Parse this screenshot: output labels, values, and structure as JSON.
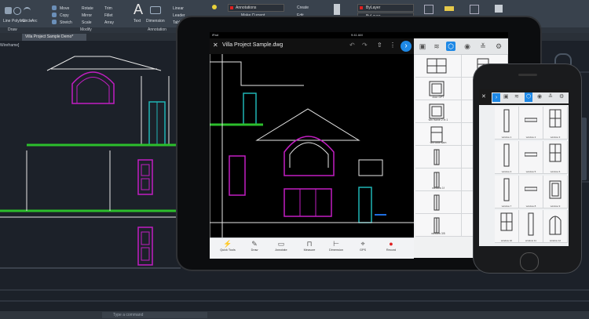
{
  "ribbon": {
    "tools": [
      {
        "label": "Line",
        "icon": "line-icon"
      },
      {
        "label": "Polyline",
        "icon": "polyline-icon"
      },
      {
        "label": "Circle",
        "icon": "circle-icon"
      },
      {
        "label": "Arc",
        "icon": "arc-icon"
      },
      {
        "label": "Move",
        "icon": "move-icon"
      },
      {
        "label": "Rotate",
        "icon": "rotate-icon"
      },
      {
        "label": "Trim",
        "icon": "trim-icon"
      },
      {
        "label": "Copy",
        "icon": "copy-icon"
      },
      {
        "label": "Mirror",
        "icon": "mirror-icon"
      },
      {
        "label": "Fillet",
        "icon": "fillet-icon"
      },
      {
        "label": "Stretch",
        "icon": "stretch-icon"
      },
      {
        "label": "Scale",
        "icon": "scale-icon"
      },
      {
        "label": "Array",
        "icon": "array-icon"
      },
      {
        "label": "Text",
        "icon": "text-icon"
      },
      {
        "label": "Dimension",
        "icon": "dimension-icon"
      },
      {
        "label": "Linear",
        "icon": "linear-icon"
      },
      {
        "label": "Leader",
        "icon": "leader-icon"
      },
      {
        "label": "Table",
        "icon": "table-icon"
      },
      {
        "label": "Annotations",
        "icon": "layer-icon"
      },
      {
        "label": "Make Current",
        "icon": "make-current-icon"
      },
      {
        "label": "Create",
        "icon": "create-icon"
      },
      {
        "label": "Edit",
        "icon": "edit-icon"
      },
      {
        "label": "ByLayer",
        "icon": "color-icon"
      },
      {
        "label": "ByLayer",
        "icon": "linetype-icon"
      }
    ],
    "panels": [
      "Draw",
      "Modify",
      "Annotation"
    ]
  },
  "file_tab": "Villa Project Sample Demo*",
  "viewport_label": "Wireframe]",
  "command_placeholder": "Type a command",
  "tablet": {
    "status_left": "iPad",
    "status_time": "9:41 AM",
    "title": "Villa Project Sample.dwg",
    "toolbar": [
      {
        "label": "Quick Tools",
        "icon": "quick-tools-icon"
      },
      {
        "label": "Draw",
        "icon": "draw-icon"
      },
      {
        "label": "Annotate",
        "icon": "annotate-icon"
      },
      {
        "label": "Measure",
        "icon": "measure-icon"
      },
      {
        "label": "Dimension",
        "icon": "dimension-icon"
      },
      {
        "label": "GPS",
        "icon": "gps-icon"
      },
      {
        "label": "Record",
        "icon": "record-icon"
      }
    ],
    "blocks": [
      "",
      "",
      "door DPT",
      "",
      "win frame 2 in 1",
      "win frame frame 2",
      "win door sam",
      "window 2",
      "",
      "",
      "window 1f",
      "window 2f",
      "",
      "",
      "window 3/5",
      "window fixt"
    ]
  },
  "phone": {
    "blocks": [
      "window 1",
      "window 2",
      "window 3",
      "window 4",
      "window 5",
      "window 6",
      "window 7",
      "window 8",
      "window 9",
      "window 10",
      "window 11",
      "window 12"
    ]
  },
  "colors": {
    "cad_background": "#1c2129",
    "magenta": "#c21ec2",
    "cyan": "#1fb5b5",
    "green": "#2cbe2c",
    "white_line": "#e8e8e8",
    "accent_blue": "#1e88e5",
    "record_red": "#e02020"
  }
}
